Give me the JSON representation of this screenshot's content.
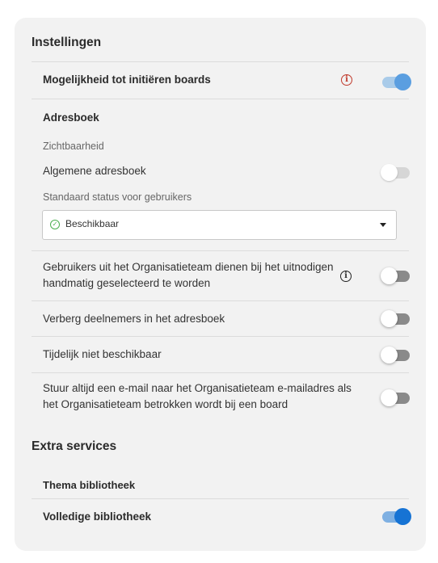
{
  "settings": {
    "title": "Instellingen",
    "boards_label": "Mogelijkheid tot initiëren boards",
    "addressbook_title": "Adresboek",
    "visibility_label": "Zichtbaarheid",
    "general_addressbook_label": "Algemene adresboek",
    "default_status_label": "Standaard status voor gebruikers",
    "default_status_value": "Beschikbaar",
    "team_select_line1": "Gebruikers uit het Organisatieteam dienen bij het uitnodigen",
    "team_select_line2": "handmatig geselecteerd te worden",
    "hide_participants_label": "Verberg deelnemers in het adresboek",
    "temp_unavailable_label": "Tijdelijk niet beschikbaar",
    "email_line1": "Stuur altijd een e-mail naar het Organisatieteam e-mailadres als",
    "email_line2": "het Organisatieteam betrokken wordt bij een board"
  },
  "extra": {
    "title": "Extra services",
    "theme_library_label": "Thema bibliotheek",
    "full_library_label": "Volledige bibliotheek"
  },
  "toggles": {
    "boards": true,
    "general_addressbook": false,
    "team_select": false,
    "hide_participants": false,
    "temp_unavailable": false,
    "email_team": false,
    "full_library": true
  },
  "colors": {
    "accent": "#1673d4",
    "warning": "#c0392b",
    "available": "#4caf50"
  }
}
